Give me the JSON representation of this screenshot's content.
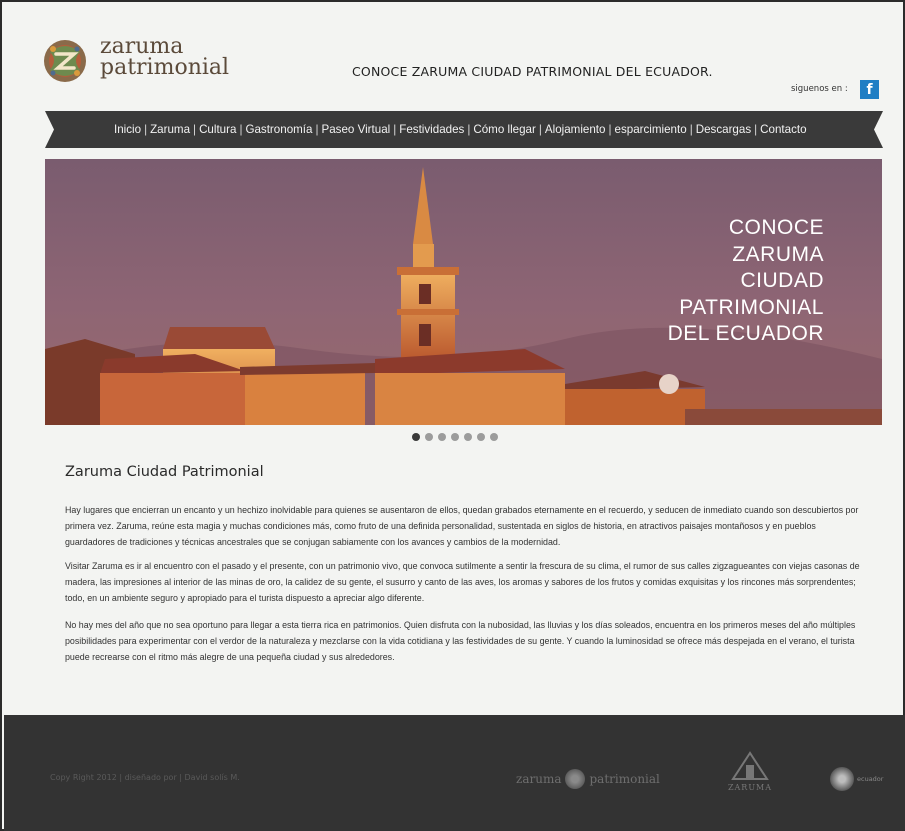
{
  "brand": {
    "logo_line1": "zaruma",
    "logo_line2": "patrimonial",
    "tagline": "CONOCE ZARUMA CIUDAD PATRIMONIAL DEL ECUADOR."
  },
  "social": {
    "follow_label": "siguenos en :",
    "facebook_glyph": "f",
    "facebook_color": "#1f7ec4"
  },
  "nav": {
    "items": [
      "Inicio",
      "Zaruma",
      "Cultura",
      "Gastronomía",
      "Paseo Virtual",
      "Festividades",
      "Cómo llegar ",
      "Alojamiento",
      "esparcimiento",
      "Descargas",
      "Contacto"
    ]
  },
  "hero": {
    "lines": [
      "CONOCE",
      "ZARUMA",
      "CIUDAD",
      "PATRIMONIAL",
      "DEL ECUADOR"
    ],
    "slides_total": 7,
    "active_slide": 1
  },
  "content": {
    "title": "Zaruma Ciudad Patrimonial",
    "paragraphs": [
      "Hay lugares que encierran un encanto y un hechizo inolvidable para quienes se ausentaron de ellos, quedan grabados eternamente en el recuerdo,  y seducen de inmediato cuando son descubiertos por primera vez. Zaruma, reúne esta magia y muchas condiciones más, como fruto de una definida personalidad, sustentada en siglos de historia, en atractivos paisajes montañosos y en pueblos guardadores de  tradiciones y técnicas  ancestrales que se conjugan sabiamente con los avances y cambios de la modernidad.",
      "Visitar Zaruma es ir al encuentro con el pasado y el presente, con un patrimonio vivo, que convoca sutilmente a sentir la frescura  de su clima, el rumor de sus calles zigzagueantes con viejas casonas de madera, las impresiones al interior de las minas de oro, la calidez de su gente, el susurro y  canto de las aves, los aromas y sabores de los frutos y comidas exquisitas y  los rincones más sorprendentes; todo, en un ambiente seguro y apropiado para el turista dispuesto a apreciar algo diferente.",
      "No hay mes del año que no sea oportuno para llegar a esta tierra rica en patrimonios. Quien disfruta con la nubosidad, las lluvias y los días soleados, encuentra en los primeros meses del año múltiples posibilidades para experimentar con el verdor de la naturaleza y mezclarse con la vida cotidiana y  las festividades de su  gente. Y cuando la luminosidad se ofrece más despejada en el verano,   el turista puede recrearse con el ritmo más alegre de una pequeña ciudad  y sus alrededores."
    ]
  },
  "footer": {
    "copyright": "Copy Right 2012 | diseñado por | David solís M.",
    "logo_left": "zaruma",
    "logo_right": "patrimonial",
    "zaruma_badge": "ZARUMA",
    "ecuador_label": "ecuador"
  }
}
